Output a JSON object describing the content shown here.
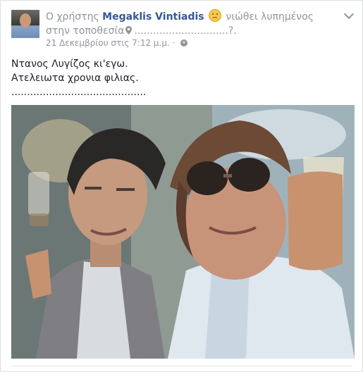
{
  "post": {
    "prefix": "Ο χρήστης",
    "author": "Megaklis Vintiadis",
    "feeling": "νιώθει λυπημένος",
    "location_lead": "στην τοποθεσία",
    "location": "..............................?.",
    "date": "21 Δεκεμβρίου στις 7:12 μ.μ.",
    "privacy_separator": "·",
    "body_lines": [
      "Ντανος Λυγίζος κι'εγω.",
      "Ατελειωτα χρονια φιλιας.",
      "..........................................."
    ]
  },
  "icons": {
    "avatar": "profile-photo",
    "feeling": "sad-face-emoji",
    "location": "map-pin-icon",
    "privacy": "globe-icon",
    "menu": "chevron-down-icon"
  },
  "colors": {
    "author_link": "#365899",
    "meta_text": "#90949c",
    "body_text": "#1d2129",
    "background": "#e9ebee"
  }
}
